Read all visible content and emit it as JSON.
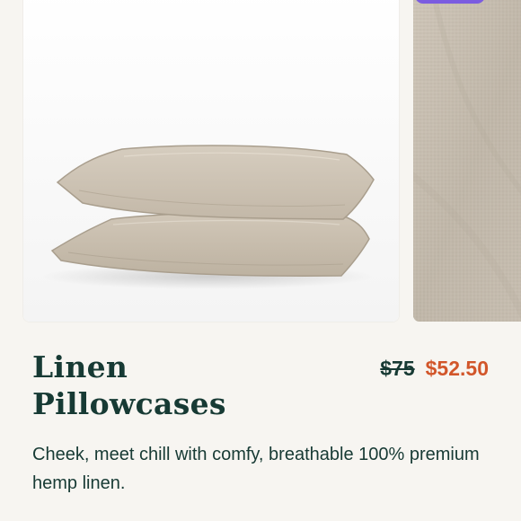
{
  "product": {
    "title": "Linen Pillowcases",
    "original_price": "$75",
    "sale_price": "$52.50",
    "description": "Cheek, meet chill with comfy, breathable 100% premium hemp linen."
  },
  "colors": {
    "background": "#f7f5f1",
    "title": "#173a34",
    "sale_price": "#d2562a",
    "badge": "#7b5ce0",
    "linen": "#c9c0b3"
  }
}
